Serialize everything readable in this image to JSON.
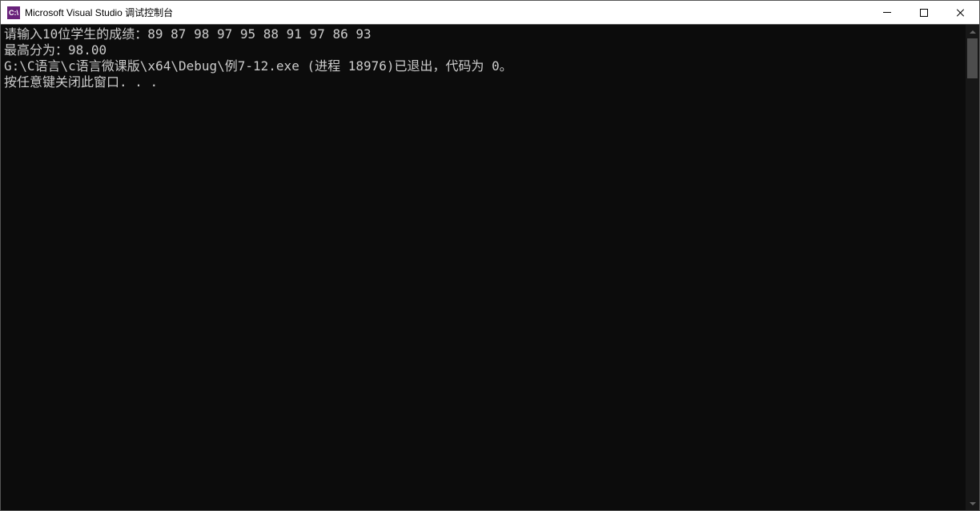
{
  "window": {
    "title": "Microsoft Visual Studio 调试控制台",
    "icon_text": "C:\\"
  },
  "console": {
    "lines": [
      "请输入10位学生的成绩：89 87 98 97 95 88 91 97 86 93",
      "最高分为：98.00",
      "G:\\C语言\\c语言微课版\\x64\\Debug\\例7-12.exe (进程 18976)已退出，代码为 0。",
      "按任意键关闭此窗口. . ."
    ]
  }
}
